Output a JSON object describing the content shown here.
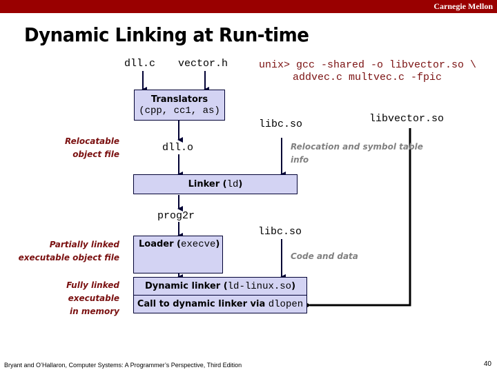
{
  "header": {
    "brand": "Carnegie Mellon",
    "bar_color": "#990000"
  },
  "slide": {
    "title": "Dynamic Linking at Run-time",
    "sources": {
      "dll_c": "dll.c",
      "vector_h": "vector.h"
    },
    "command": {
      "line1": "unix> gcc -shared -o libvector.so \\",
      "line2": "addvec.c multvec.c -fpic"
    },
    "boxes": {
      "translators_line1": "Translators",
      "translators_line2": "(cpp, cc1, as)",
      "linker_label": "Linker (",
      "linker_code": "ld",
      "linker_close": ")",
      "loader_label": "Loader (",
      "loader_code": "execve",
      "loader_close": ")",
      "dynlinker_label": "Dynamic linker (",
      "dynlinker_code": "ld-linux.so",
      "dynlinker_close": ")",
      "dlopen_label": "Call to dynamic linker via ",
      "dlopen_code": "dlopen"
    },
    "files": {
      "dll_o": "dll.o",
      "libc_so_top": "libc.so",
      "libvector_so": "libvector.so",
      "prog2r": "prog2r",
      "libc_so_bottom": "libc.so"
    },
    "annotations": {
      "relocatable": [
        "Relocatable",
        "object file"
      ],
      "partially_linked": [
        "Partially linked",
        "executable object file"
      ],
      "fully_linked": [
        "Fully linked",
        "executable",
        "in memory"
      ],
      "relocation_info": [
        "Relocation and symbol  table",
        "info"
      ],
      "code_and_data": "Code and data"
    },
    "box_fill": "#d3d3f3",
    "arrow_color": "#000033"
  },
  "footer": {
    "citation": "Bryant and O’Hallaron, Computer Systems: A Programmer’s Perspective, Third Edition",
    "page_number": "40"
  }
}
